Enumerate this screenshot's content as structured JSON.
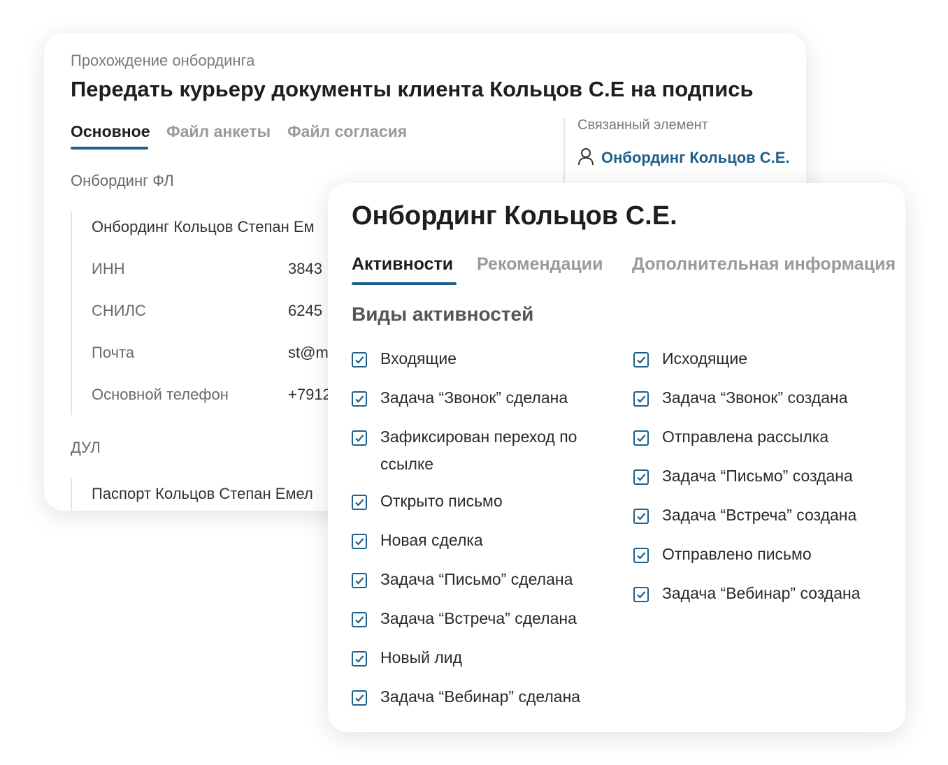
{
  "back_card": {
    "breadcrumb": "Прохождение онбординга",
    "title": "Передать курьеру документы клиента Кольцов С.Е на подпись",
    "tabs": [
      "Основное",
      "Файл анкеты",
      "Файл согласия"
    ],
    "section_onboarding_label": "Онбординг ФЛ",
    "onboarding_link": "Онбординг Кольцов Степан Ем",
    "fields": [
      {
        "label": "ИНН",
        "value": "3843"
      },
      {
        "label": "СНИЛС",
        "value": "6245"
      },
      {
        "label": "Почта",
        "value": "st@m"
      },
      {
        "label": "Основной телефон",
        "value": "+7912"
      }
    ],
    "section_dul_label": "ДУЛ",
    "dul_link": "Паспорт Кольцов Степан Емел",
    "related": {
      "title": "Связанный элемент",
      "link_label": "Онбординг Кольцов С.Е.",
      "icon": "person-icon"
    }
  },
  "front_card": {
    "title": "Онбординг Кольцов С.Е.",
    "tabs": [
      "Активности",
      "Рекомендации",
      "Дополнительная информация"
    ],
    "heading": "Виды активностей",
    "left_items": [
      "Входящие",
      "Задача “Звонок” сделана",
      "Зафиксирован переход по ссылке",
      "Открыто письмо",
      "Новая сделка",
      "Задача “Письмо” сделана",
      "Задача “Встреча” сделана",
      "Новый лид",
      "Задача “Вебинар” сделана"
    ],
    "right_items": [
      "Исходящие",
      "Задача “Звонок” создана",
      "Отправлена рассылка",
      "Задача “Письмо” создана",
      "Задача “Встреча” создана",
      "Отправлено письмо",
      "Задача “Вебинар” создана"
    ],
    "checked": true
  },
  "colors": {
    "accent": "#1f5f8b",
    "muted_text": "#7a7a7a",
    "inactive_tab": "#9a9a9a"
  }
}
